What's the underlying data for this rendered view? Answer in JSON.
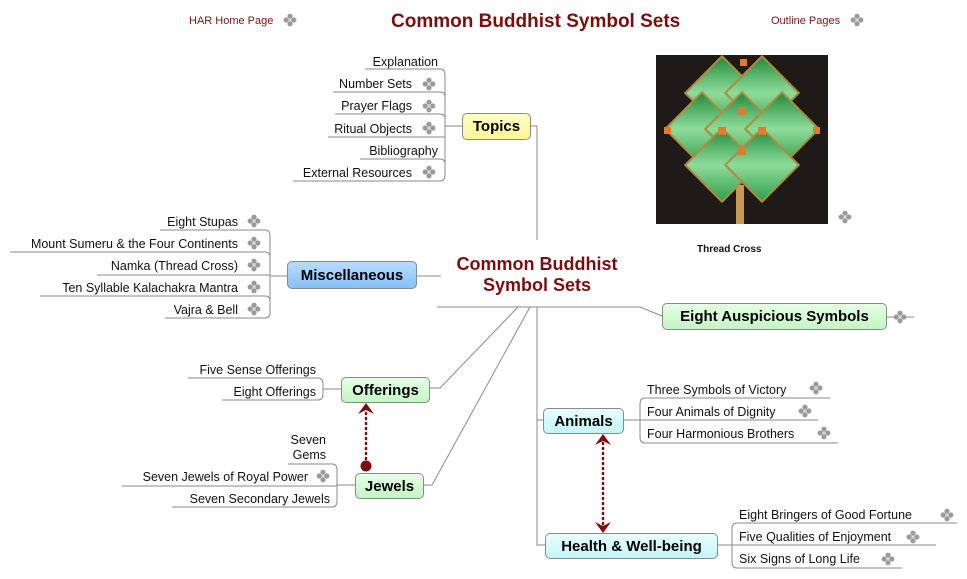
{
  "header": {
    "home_link": "HAR Home Page",
    "title": "Common Buddhist Symbol Sets",
    "outline_link": "Outline Pages"
  },
  "central_topic": {
    "line1": "Common Buddhist",
    "line2": "Symbol Sets",
    "color": "#7a0e0e"
  },
  "image": {
    "caption": "Thread Cross",
    "alt": "Namka thread cross"
  },
  "branches": {
    "topics": {
      "label": "Topics",
      "color": "#fbf49a",
      "items": [
        {
          "label": "Explanation",
          "link": false
        },
        {
          "label": "Number Sets",
          "link": true
        },
        {
          "label": "Prayer Flags",
          "link": true
        },
        {
          "label": "Ritual Objects",
          "link": true
        },
        {
          "label": "Bibliography",
          "link": false
        },
        {
          "label": "External Resources",
          "link": true
        }
      ]
    },
    "miscellaneous": {
      "label": "Miscellaneous",
      "color": "#86c0f6",
      "items": [
        {
          "label": "Eight Stupas",
          "link": true
        },
        {
          "label": "Mount Sumeru & the Four Continents",
          "link": true
        },
        {
          "label": "Namka (Thread Cross)",
          "link": true
        },
        {
          "label": "Ten Syllable Kalachakra Mantra",
          "link": true
        },
        {
          "label": "Vajra & Bell",
          "link": true
        }
      ]
    },
    "eight_auspicious": {
      "label": "Eight Auspicious Symbols",
      "color": "#c5f5c5",
      "link": true
    },
    "offerings": {
      "label": "Offerings",
      "color": "#c5f5c5",
      "items": [
        {
          "label": "Five Sense Offerings",
          "link": false
        },
        {
          "label": "Eight Offerings",
          "link": false
        }
      ]
    },
    "jewels": {
      "label": "Jewels",
      "color": "#c5f5c5",
      "items": [
        {
          "label_line1": "Seven",
          "label_line2": "Gems",
          "link": false
        },
        {
          "label": "Seven Jewels of Royal Power",
          "link": true
        },
        {
          "label": "Seven Secondary Jewels",
          "link": false
        }
      ]
    },
    "animals": {
      "label": "Animals",
      "color": "#c4f4f8",
      "items": [
        {
          "label": "Three Symbols of Victory",
          "link": true
        },
        {
          "label": "Four Animals of Dignity",
          "link": true
        },
        {
          "label": "Four Harmonious Brothers",
          "link": true
        }
      ]
    },
    "health": {
      "label": "Health & Well-being",
      "color": "#c4f4f8",
      "items": [
        {
          "label": "Eight Bringers of Good Fortune",
          "link": true
        },
        {
          "label": "Five Qualities of Enjoyment",
          "link": true
        },
        {
          "label": "Six Signs of Long Life",
          "link": true
        }
      ]
    }
  },
  "relationships": [
    {
      "from": "Jewels",
      "to": "Offerings",
      "style": "dotted-arrow"
    },
    {
      "from": "Animals",
      "to": "Health & Well-being",
      "style": "dotted-double-arrow"
    }
  ],
  "colors": {
    "relationship": "#7a0e0e",
    "connector": "#808080",
    "link_icon": "#9a9a9a"
  }
}
